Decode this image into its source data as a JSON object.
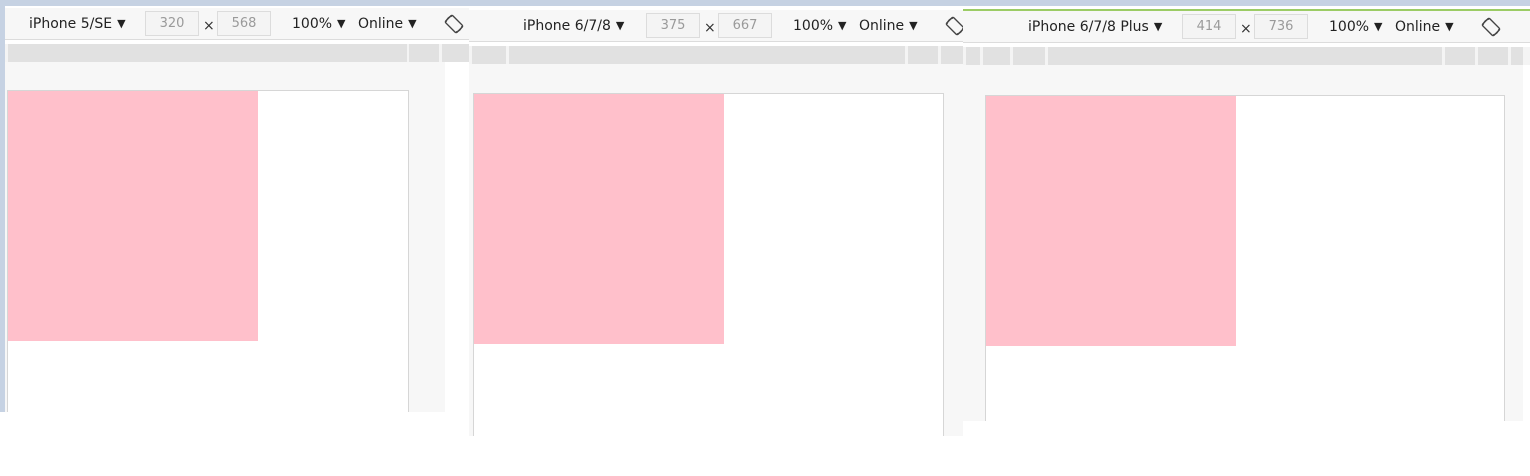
{
  "colors": {
    "box": "#ffc0cb",
    "frame_accent": "#9ccc65"
  },
  "panels": [
    {
      "device": "iPhone 5/SE",
      "width": "320",
      "height": "568",
      "times": "×",
      "zoom": "100%",
      "network": "Online",
      "rotate_icon": "rotate-icon"
    },
    {
      "device": "iPhone 6/7/8",
      "width": "375",
      "height": "667",
      "times": "×",
      "zoom": "100%",
      "network": "Online",
      "rotate_icon": "rotate-icon"
    },
    {
      "device": "iPhone 6/7/8 Plus",
      "width": "414",
      "height": "736",
      "times": "×",
      "zoom": "100%",
      "network": "Online",
      "rotate_icon": "rotate-icon"
    }
  ]
}
